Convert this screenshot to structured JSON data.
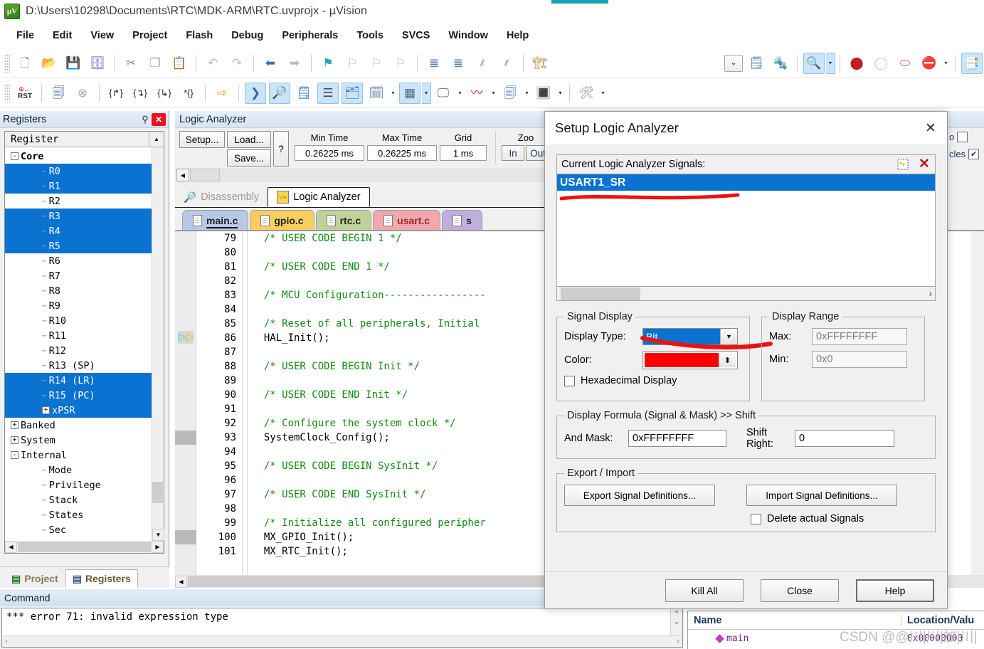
{
  "window": {
    "title": "D:\\Users\\10298\\Documents\\RTC\\MDK-ARM\\RTC.uvprojx - µVision",
    "app_icon_text": "µV"
  },
  "menubar": {
    "items": [
      "File",
      "Edit",
      "View",
      "Project",
      "Flash",
      "Debug",
      "Peripherals",
      "Tools",
      "SVCS",
      "Window",
      "Help"
    ]
  },
  "toolbar_row1": {
    "icons": [
      {
        "name": "new-file-icon",
        "glyph": "📄"
      },
      {
        "name": "open-folder-icon",
        "glyph": "📂"
      },
      {
        "name": "save-icon",
        "glyph": "💾"
      },
      {
        "name": "save-all-icon",
        "glyph": "📘"
      },
      {
        "name": "cut-icon",
        "glyph": "✂"
      },
      {
        "name": "copy-icon",
        "glyph": "❐"
      },
      {
        "name": "paste-icon",
        "glyph": "📋"
      },
      {
        "name": "undo-icon",
        "glyph": "↶"
      },
      {
        "name": "redo-icon",
        "glyph": "↷"
      },
      {
        "name": "navigate-back-icon",
        "glyph": "⬅"
      },
      {
        "name": "navigate-forward-icon",
        "glyph": "➡"
      },
      {
        "name": "bookmark-toggle-icon",
        "glyph": "⚑"
      },
      {
        "name": "bookmark-prev-icon",
        "glyph": "⚐"
      },
      {
        "name": "bookmark-next-icon",
        "glyph": "⚐"
      },
      {
        "name": "bookmark-clear-icon",
        "glyph": "⚐"
      },
      {
        "name": "indent-icon",
        "glyph": "≡"
      },
      {
        "name": "outdent-icon",
        "glyph": "≡"
      },
      {
        "name": "comment-icon",
        "glyph": "//"
      },
      {
        "name": "uncomment-icon",
        "glyph": "//"
      },
      {
        "name": "build-icon",
        "glyph": "🏗"
      }
    ],
    "right_icons": [
      {
        "name": "target-dropdown-icon",
        "glyph": "⌄"
      },
      {
        "name": "target-options-icon",
        "glyph": "📝"
      },
      {
        "name": "manage-components-icon",
        "glyph": "🔧"
      },
      {
        "name": "start-debug-session-icon",
        "glyph": "🔍"
      },
      {
        "name": "insert-breakpoint-icon",
        "glyph": "⚫"
      },
      {
        "name": "disable-breakpoint-icon",
        "glyph": "⚪"
      },
      {
        "name": "disable-all-breakpoints-icon",
        "glyph": "⭕"
      },
      {
        "name": "kill-all-breakpoints-icon",
        "glyph": "⛔"
      },
      {
        "name": "project-window-icon",
        "glyph": "📑"
      }
    ]
  },
  "toolbar_row2": {
    "icons": [
      {
        "name": "reset-cpu-icon",
        "glyph": "RST"
      },
      {
        "name": "run-icon",
        "glyph": "📃"
      },
      {
        "name": "stop-icon",
        "glyph": "ⓧ"
      },
      {
        "name": "step-icon",
        "glyph": "{→}"
      },
      {
        "name": "step-over-icon",
        "glyph": "{↷}"
      },
      {
        "name": "step-out-icon",
        "glyph": "{↰}"
      },
      {
        "name": "run-to-cursor-icon",
        "glyph": "*{}"
      },
      {
        "name": "show-next-statement-icon",
        "glyph": "⇨"
      },
      {
        "name": "command-window-icon",
        "glyph": "❯"
      },
      {
        "name": "disassembly-window-icon",
        "glyph": "🔎"
      },
      {
        "name": "symbols-window-icon",
        "glyph": "📒"
      },
      {
        "name": "registers-window-icon",
        "glyph": "☰"
      },
      {
        "name": "call-stack-window-icon",
        "glyph": "📊"
      },
      {
        "name": "watch-windows-icon",
        "glyph": "🗒"
      },
      {
        "name": "memory-windows-icon",
        "glyph": "▦"
      },
      {
        "name": "serial-windows-icon",
        "glyph": "🖵"
      },
      {
        "name": "analysis-windows-icon",
        "glyph": "〰"
      },
      {
        "name": "trace-windows-icon",
        "glyph": "📉"
      },
      {
        "name": "system-analyzer-icon",
        "glyph": "🔲"
      },
      {
        "name": "tools-icon",
        "glyph": "🛠"
      }
    ]
  },
  "registers_pane": {
    "title": "Registers",
    "column_header": "Register",
    "tree": [
      {
        "label": "Core",
        "indent": 0,
        "expander": "-",
        "selected": false,
        "bold": true
      },
      {
        "label": "R0",
        "indent": 2,
        "expander": "",
        "selected": true
      },
      {
        "label": "R1",
        "indent": 2,
        "expander": "",
        "selected": true
      },
      {
        "label": "R2",
        "indent": 2,
        "expander": "",
        "selected": false
      },
      {
        "label": "R3",
        "indent": 2,
        "expander": "",
        "selected": true
      },
      {
        "label": "R4",
        "indent": 2,
        "expander": "",
        "selected": true
      },
      {
        "label": "R5",
        "indent": 2,
        "expander": "",
        "selected": true
      },
      {
        "label": "R6",
        "indent": 2,
        "expander": "",
        "selected": false
      },
      {
        "label": "R7",
        "indent": 2,
        "expander": "",
        "selected": false
      },
      {
        "label": "R8",
        "indent": 2,
        "expander": "",
        "selected": false
      },
      {
        "label": "R9",
        "indent": 2,
        "expander": "",
        "selected": false
      },
      {
        "label": "R10",
        "indent": 2,
        "expander": "",
        "selected": false
      },
      {
        "label": "R11",
        "indent": 2,
        "expander": "",
        "selected": false
      },
      {
        "label": "R12",
        "indent": 2,
        "expander": "",
        "selected": false
      },
      {
        "label": "R13 (SP)",
        "indent": 2,
        "expander": "",
        "selected": false
      },
      {
        "label": "R14 (LR)",
        "indent": 2,
        "expander": "",
        "selected": true
      },
      {
        "label": "R15 (PC)",
        "indent": 2,
        "expander": "",
        "selected": true
      },
      {
        "label": "xPSR",
        "indent": 2,
        "expander": "+",
        "selected": true
      },
      {
        "label": "Banked",
        "indent": 0,
        "expander": "+",
        "selected": false
      },
      {
        "label": "System",
        "indent": 0,
        "expander": "+",
        "selected": false
      },
      {
        "label": "Internal",
        "indent": 0,
        "expander": "-",
        "selected": false
      },
      {
        "label": "Mode",
        "indent": 2,
        "expander": "",
        "selected": false
      },
      {
        "label": "Privilege",
        "indent": 2,
        "expander": "",
        "selected": false
      },
      {
        "label": "Stack",
        "indent": 2,
        "expander": "",
        "selected": false
      },
      {
        "label": "States",
        "indent": 2,
        "expander": "",
        "selected": false
      },
      {
        "label": "Sec",
        "indent": 2,
        "expander": "",
        "selected": false
      }
    ],
    "tabs": [
      {
        "label": "Project",
        "active": false
      },
      {
        "label": "Registers",
        "active": true
      }
    ]
  },
  "logic_analyzer": {
    "title": "Logic Analyzer",
    "setup_button": "Setup...",
    "load_button": "Load...",
    "save_button": "Save...",
    "help_button": "?",
    "fields": [
      {
        "label": "Min Time",
        "value": "0.26225 ms"
      },
      {
        "label": "Max Time",
        "value": "0.26225 ms"
      },
      {
        "label": "Grid",
        "value": "1 ms"
      }
    ],
    "zoom_label": "Zoo",
    "zoom_in": "In",
    "zoom_out": "Out"
  },
  "window_tabs": [
    {
      "label": "Disassembly",
      "active": false,
      "icon": "disassembly-icon"
    },
    {
      "label": "Logic Analyzer",
      "active": true,
      "icon": "logic-analyzer-icon"
    }
  ],
  "file_tabs": [
    {
      "label": "main.c",
      "active": true,
      "color": "#b8c8e8"
    },
    {
      "label": "gpio.c",
      "active": false,
      "color": "#f8cf5e"
    },
    {
      "label": "rtc.c",
      "active": false,
      "color": "#bed29a"
    },
    {
      "label": "usart.c",
      "active": false,
      "color": "#f0a8ac"
    },
    {
      "label": "s",
      "active": false,
      "color": "#c0aee0"
    }
  ],
  "editor": {
    "lines": [
      {
        "no": "79",
        "text": "  /* USER CODE BEGIN 1 */",
        "type": "comment"
      },
      {
        "no": "80",
        "text": "",
        "type": "code"
      },
      {
        "no": "81",
        "text": "  /* USER CODE END 1 */",
        "type": "comment"
      },
      {
        "no": "82",
        "text": "",
        "type": "code"
      },
      {
        "no": "83",
        "text": "  /* MCU Configuration-----------------",
        "type": "comment"
      },
      {
        "no": "84",
        "text": "",
        "type": "code"
      },
      {
        "no": "85",
        "text": "  /* Reset of all peripherals, Initial",
        "type": "comment"
      },
      {
        "no": "86",
        "text": "  HAL_Init();",
        "type": "code",
        "marker": "current"
      },
      {
        "no": "87",
        "text": "",
        "type": "code"
      },
      {
        "no": "88",
        "text": "  /* USER CODE BEGIN Init */",
        "type": "comment"
      },
      {
        "no": "89",
        "text": "",
        "type": "code"
      },
      {
        "no": "90",
        "text": "  /* USER CODE END Init */",
        "type": "comment"
      },
      {
        "no": "91",
        "text": "",
        "type": "code"
      },
      {
        "no": "92",
        "text": "  /* Configure the system clock */",
        "type": "comment"
      },
      {
        "no": "93",
        "text": "  SystemClock_Config();",
        "type": "code",
        "marker": "gray"
      },
      {
        "no": "94",
        "text": "",
        "type": "code"
      },
      {
        "no": "95",
        "text": "  /* USER CODE BEGIN SysInit */",
        "type": "comment"
      },
      {
        "no": "96",
        "text": "",
        "type": "code"
      },
      {
        "no": "97",
        "text": "  /* USER CODE END SysInit */",
        "type": "comment"
      },
      {
        "no": "98",
        "text": "",
        "type": "code"
      },
      {
        "no": "99",
        "text": "  /* Initialize all configured peripher",
        "type": "comment"
      },
      {
        "no": "100",
        "text": "  MX_GPIO_Init();",
        "type": "code",
        "marker": "gray"
      },
      {
        "no": "101",
        "text": "  MX_RTC_Init();",
        "type": "code"
      }
    ]
  },
  "right_sliver": {
    "rows": [
      {
        "label": "o",
        "checked": false
      },
      {
        "label": "cles",
        "checked": true
      }
    ]
  },
  "command_pane": {
    "title": "Command",
    "output": "*** error 71: invalid expression type"
  },
  "watch_pane": {
    "columns": [
      "Name",
      "Location/Valu"
    ],
    "rows": [
      {
        "name": "main",
        "value": "0x00000000"
      }
    ]
  },
  "watermark": "CSDN @@川|川|加|川|",
  "dialog": {
    "title": "Setup Logic Analyzer",
    "close_icon": "✕",
    "signals_label": "Current Logic Analyzer Signals:",
    "new_signal_icon": "📄",
    "delete_signal_icon": "✕",
    "signals": [
      {
        "name": "USART1_SR",
        "selected": true
      }
    ],
    "signal_display": {
      "legend": "Signal Display",
      "display_type_label": "Display Type:",
      "display_type_value": "Bit",
      "color_label": "Color:",
      "color_value": "#ff0000",
      "hex_checkbox_label": "Hexadecimal Display",
      "hex_checked": false
    },
    "display_range": {
      "legend": "Display Range",
      "max_label": "Max:",
      "max_value": "0xFFFFFFFF",
      "min_label": "Min:",
      "min_value": "0x0"
    },
    "display_formula": {
      "legend": "Display Formula (Signal & Mask) >> Shift",
      "and_mask_label": "And Mask:",
      "and_mask_value": "0xFFFFFFFF",
      "shift_right_label": "Shift Right:",
      "shift_right_value": "0"
    },
    "export_import": {
      "legend": "Export / Import",
      "export_button": "Export Signal Definitions...",
      "import_button": "Import Signal Definitions...",
      "delete_checkbox_label": "Delete actual Signals",
      "delete_checked": false
    },
    "footer": {
      "kill_all": "Kill All",
      "close": "Close",
      "help": "Help"
    }
  }
}
